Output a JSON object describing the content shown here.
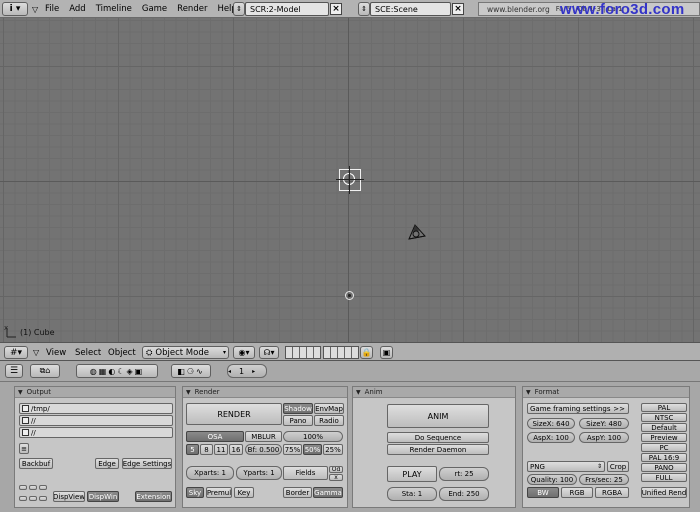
{
  "topbar": {
    "menu": [
      "File",
      "Add",
      "Timeline",
      "Game",
      "Render",
      "Help"
    ],
    "screen": "SCR:2-Model",
    "scene": "SCE:Scene",
    "url": "www.blender.org",
    "watermark": "www.foro3d.com",
    "stats": "Fa:6 | Ob:1-3 | La:1"
  },
  "viewport": {
    "active_object": "(1) Cube",
    "axis_label": "x"
  },
  "header3d": {
    "view": "View",
    "select": "Select",
    "object": "Object",
    "mode": "Object Mode"
  },
  "buttons_header": {
    "frame": "1"
  },
  "output": {
    "title": "Output",
    "paths": [
      "/tmp/",
      "//",
      "//"
    ],
    "small": "≡",
    "backbuf": "Backbuf",
    "edge": "Edge",
    "edge_settings": "Edge Settings",
    "dispview": "DispView",
    "dispwin": "DispWin",
    "extension": "Extension"
  },
  "render": {
    "title": "Render",
    "render_btn": "RENDER",
    "shadow": "Shadow",
    "envmap": "EnvMap",
    "pano": "Pano",
    "radio": "Radio",
    "osa": "OSA",
    "mblur": "MBLUR",
    "pct100": "100%",
    "osa_levels": [
      "5",
      "8",
      "11",
      "16"
    ],
    "bf": "Bf: 0.500",
    "pct75": "75%",
    "pct50": "50%",
    "pct25": "25%",
    "xparts": "Xparts: 1",
    "yparts": "Yparts: 1",
    "fields": "Fields",
    "odd": "Od",
    "x": "x",
    "sky": "Sky",
    "premul": "Premul",
    "key": "Key",
    "border": "Border",
    "gamma": "Gamma"
  },
  "anim": {
    "title": "Anim",
    "anim_btn": "ANIM",
    "do_sequence": "Do Sequence",
    "render_daemon": "Render Daemon",
    "play": "PLAY",
    "rt": "rt: 25",
    "sta": "Sta: 1",
    "end": "End: 250"
  },
  "format": {
    "title": "Format",
    "game_framing": "Game framing settings",
    "arrows": ">>",
    "sizex": "SizeX: 640",
    "sizey": "SizeY: 480",
    "aspx": "AspX: 100",
    "aspy": "AspY: 100",
    "filetype": "PNG",
    "crop": "Crop",
    "quality": "Quality: 100",
    "frs_sec": "Frs/sec: 25",
    "bw": "BW",
    "rgb": "RGB",
    "rgba": "RGBA",
    "presets": [
      "PAL",
      "NTSC",
      "Default",
      "Preview",
      "PC",
      "PAL 16:9",
      "PANO",
      "FULL",
      "Unified Rend"
    ]
  }
}
